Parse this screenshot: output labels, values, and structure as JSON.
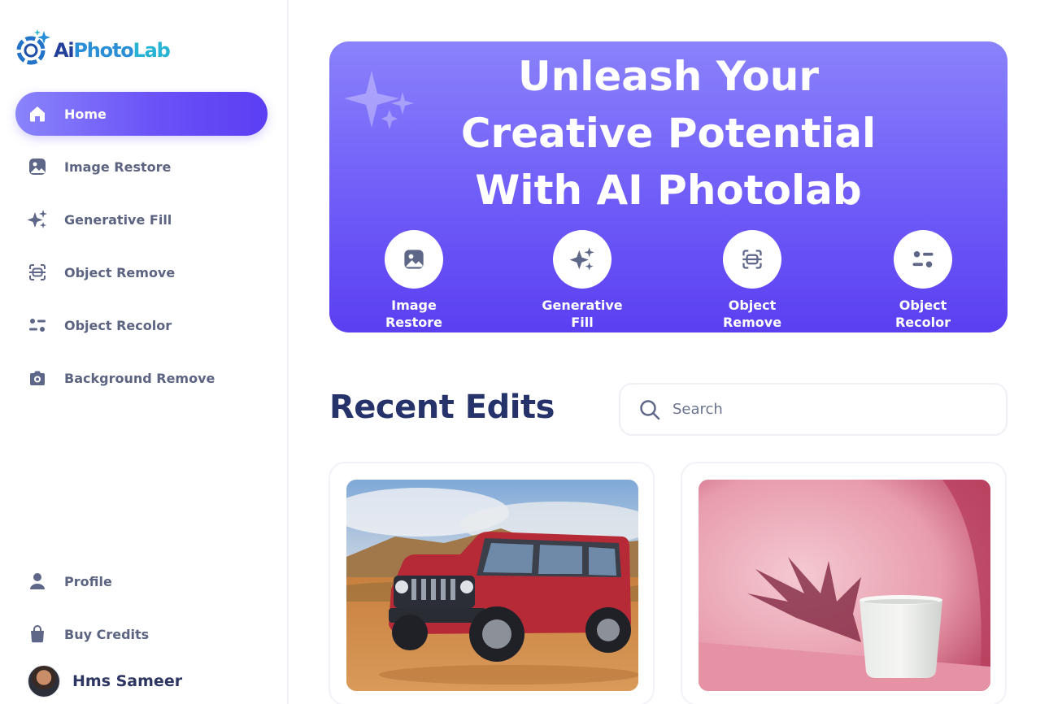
{
  "app": {
    "name_part1": "Ai",
    "name_part2": "Photo",
    "name_part3": "Lab"
  },
  "sidebar": {
    "items": [
      {
        "label": "Home",
        "icon": "home-icon",
        "active": true
      },
      {
        "label": "Image Restore",
        "icon": "image-icon"
      },
      {
        "label": "Generative Fill",
        "icon": "sparkles-icon"
      },
      {
        "label": "Object Remove",
        "icon": "scan-object-icon"
      },
      {
        "label": "Object Recolor",
        "icon": "sliders-icon"
      },
      {
        "label": "Background Remove",
        "icon": "camera-icon"
      }
    ],
    "bottom_items": [
      {
        "label": "Profile",
        "icon": "user-icon"
      },
      {
        "label": "Buy Credits",
        "icon": "shopping-bag-icon"
      }
    ],
    "user": {
      "name": "Hms Sameer"
    }
  },
  "hero": {
    "title": "Unleash Your Creative Potential With AI Photolab",
    "tools": [
      {
        "label": "Image Restore",
        "icon": "image-icon"
      },
      {
        "label": "Generative Fill",
        "icon": "sparkles-icon"
      },
      {
        "label": "Object Remove",
        "icon": "scan-object-icon"
      },
      {
        "label": "Object Recolor",
        "icon": "sliders-icon"
      }
    ]
  },
  "recent": {
    "title": "Recent Edits",
    "search_placeholder": "Search"
  },
  "colors": {
    "accent": "#6a52f7",
    "accent_light": "#8a84fb",
    "heading": "#26336a",
    "nav_text": "#5c6481"
  }
}
